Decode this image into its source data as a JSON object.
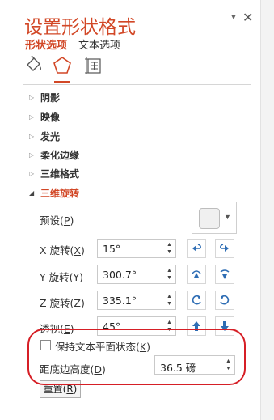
{
  "panel": {
    "title": "设置形状格式",
    "tabs": {
      "shape_options": "形状选项",
      "text_options": "文本选项"
    },
    "window_controls": {
      "pin": "▼",
      "close": "✕"
    },
    "icon_tabs": [
      "fill-line-icon",
      "effects-icon",
      "size-properties-icon"
    ],
    "accent_color": "#d24726"
  },
  "sections": [
    {
      "label": "阴影",
      "expanded": false
    },
    {
      "label": "映像",
      "expanded": false
    },
    {
      "label": "发光",
      "expanded": false
    },
    {
      "label": "柔化边缘",
      "expanded": false
    },
    {
      "label": "三维格式",
      "expanded": false
    },
    {
      "label": "三维旋转",
      "expanded": true
    }
  ],
  "rotation": {
    "preset": {
      "label_text": "预设(",
      "label_key": "P",
      "label_end": ")"
    },
    "x": {
      "label_text": "X 旋转(",
      "label_key": "X",
      "label_end": ")",
      "value": "15°"
    },
    "y": {
      "label_text": "Y 旋转(",
      "label_key": "Y",
      "label_end": ")",
      "value": "300.7°"
    },
    "z": {
      "label_text": "Z 旋转(",
      "label_key": "Z",
      "label_end": ")",
      "value": "335.1°"
    },
    "perspective": {
      "label_text": "透视(",
      "label_key": "E",
      "label_end": ")",
      "value": "45°"
    },
    "keep_flat": {
      "label_text": "保持文本平面状态(",
      "label_key": "K",
      "label_end": ")",
      "checked": false
    },
    "distance": {
      "label_text": "距底边高度(",
      "label_key": "D",
      "label_end": ")",
      "value": "36.5 磅"
    },
    "reset": {
      "label_text": "重置(",
      "label_key": "R",
      "label_end": ")"
    }
  },
  "highlight_color": "#d61f26"
}
